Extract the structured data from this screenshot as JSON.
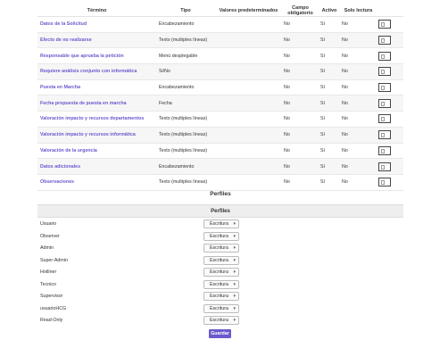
{
  "fields_table": {
    "headers": {
      "term": "Término",
      "type": "Tipo",
      "defaults": "Valores predeterminados",
      "required": "Campo obligatorio",
      "active": "Activo",
      "readonly": "Solo lectura"
    },
    "rows": [
      {
        "term": "Datos de la Solicitud",
        "type": "Encabezamiento",
        "defaults": "",
        "required": "No",
        "active": "Sí",
        "readonly": "No"
      },
      {
        "term": "Efecto de no realizarse",
        "type": "Texto (multiples líneas)",
        "defaults": "",
        "required": "No",
        "active": "Sí",
        "readonly": "No"
      },
      {
        "term": "Responsable que aprueba la petición",
        "type": "Menú desplegable",
        "defaults": "",
        "required": "No",
        "active": "Sí",
        "readonly": "No"
      },
      {
        "term": "Requiere análisis conjunto con informática",
        "type": "Si/No",
        "defaults": "",
        "required": "No",
        "active": "Sí",
        "readonly": "No"
      },
      {
        "term": "Puesta en Marcha",
        "type": "Encabezamiento",
        "defaults": "",
        "required": "No",
        "active": "Sí",
        "readonly": "No"
      },
      {
        "term": "Fecha propuesta de puesta en marcha",
        "type": "Fecha",
        "defaults": "",
        "required": "No",
        "active": "Sí",
        "readonly": "No"
      },
      {
        "term": "Valoración impacto y recursos departamentos",
        "type": "Texto (multiples líneas)",
        "defaults": "",
        "required": "No",
        "active": "Sí",
        "readonly": "No"
      },
      {
        "term": "Valoración impacto y recursos informática",
        "type": "Texto (multiples líneas)",
        "defaults": "",
        "required": "No",
        "active": "Sí",
        "readonly": "No"
      },
      {
        "term": "Valoración de la urgencia",
        "type": "Texto (multiples líneas)",
        "defaults": "",
        "required": "No",
        "active": "Sí",
        "readonly": "No"
      },
      {
        "term": "Datos adicionales",
        "type": "Encabezamiento",
        "defaults": "",
        "required": "No",
        "active": "Sí",
        "readonly": "No"
      },
      {
        "term": "Observaciones",
        "type": "Texto (multiples líneas)",
        "defaults": "",
        "required": "No",
        "active": "Sí",
        "readonly": "No"
      }
    ]
  },
  "profiles": {
    "section_title": "Perfiles",
    "table_header": "Perfiles",
    "rows": [
      {
        "name": "Usuario",
        "permission": "Escritura"
      },
      {
        "name": "Observer",
        "permission": "Escritura"
      },
      {
        "name": "Admin",
        "permission": "Escritura"
      },
      {
        "name": "Super-Admin",
        "permission": "Escritura"
      },
      {
        "name": "Hotliner",
        "permission": "Escritura"
      },
      {
        "name": "Tecnico",
        "permission": "Escritura"
      },
      {
        "name": "Supervisor",
        "permission": "Escritura"
      },
      {
        "name": "usuarioHCG",
        "permission": "Escritura"
      },
      {
        "name": "Read-Only",
        "permission": "Escritura"
      }
    ],
    "dropdown_arrow": "▾"
  },
  "save_button": {
    "label": "Guardar"
  },
  "colors": {
    "accent": "#6a5acd",
    "row_alt": "#f6f6f6"
  },
  "icons": {
    "edit": "edit-icon"
  }
}
